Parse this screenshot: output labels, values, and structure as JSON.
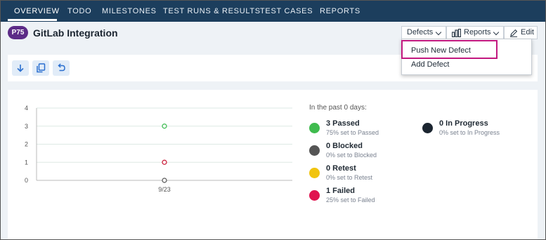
{
  "nav": {
    "tabs": [
      {
        "label": "OVERVIEW",
        "active": true
      },
      {
        "label": "TODO"
      },
      {
        "label": "MILESTONES"
      },
      {
        "label": "TEST RUNS & RESULTS"
      },
      {
        "label": "TEST CASES"
      },
      {
        "label": "REPORTS"
      }
    ]
  },
  "project": {
    "badge": "P75",
    "title": "GitLab Integration"
  },
  "header_actions": {
    "defects_label": "Defects",
    "reports_label": "Reports",
    "edit_label": "Edit"
  },
  "defects_menu": {
    "items": [
      "Push New Defect",
      "Add Defect"
    ],
    "highlighted": "Push New Defect"
  },
  "toolbar": {
    "icons": [
      "download-icon",
      "copy-icon",
      "undo-icon"
    ]
  },
  "chart_data": {
    "type": "scatter",
    "x_categories": [
      "9/23"
    ],
    "ylim": [
      0,
      4
    ],
    "yticks": [
      "0",
      "1",
      "2",
      "3",
      "4"
    ],
    "grid": true,
    "series": [
      {
        "x": "9/23",
        "y": 3,
        "color": "#34b84a"
      },
      {
        "x": "9/23",
        "y": 1,
        "color": "#c8102e"
      },
      {
        "x": "9/23",
        "y": 0,
        "color": "#555555"
      }
    ]
  },
  "stats": {
    "header": "In the past 0 days:",
    "items": [
      {
        "name": "3 Passed",
        "sub": "75% set to Passed",
        "color": "#3fbb4e"
      },
      {
        "name": "0 Blocked",
        "sub": "0% set to Blocked",
        "color": "#555555"
      },
      {
        "name": "0 Retest",
        "sub": "0% set to Retest",
        "color": "#f1c40f"
      },
      {
        "name": "1 Failed",
        "sub": "25% set to Failed",
        "color": "#e0134f"
      },
      {
        "name": "0 In Progress",
        "sub": "0% set to In Progress",
        "color": "#1b2530"
      }
    ]
  }
}
